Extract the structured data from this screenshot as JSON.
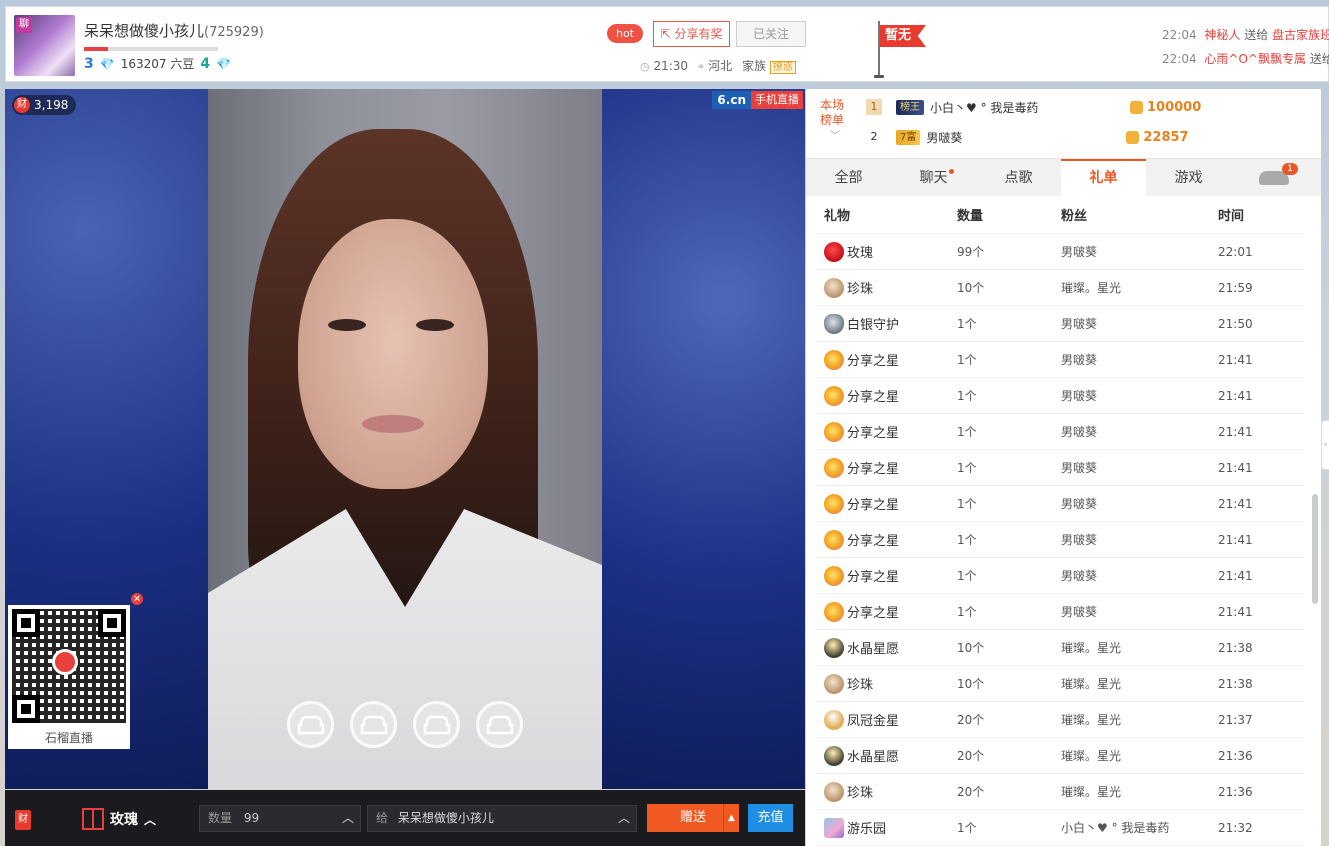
{
  "header": {
    "anchor_name": "呆呆想做傻小孩儿",
    "room_id": "(725929)",
    "avatar_badge": "聊",
    "level_left": "3",
    "coins_text": "163207 六豆",
    "level_right": "4",
    "level_progress": 0.18,
    "hot_label": "hot",
    "share_label": "分享有奖",
    "follow_label": "已关注",
    "time": "21:30",
    "location": "河北",
    "family_label": "家族",
    "family_badge": "撩惑",
    "flag_text": "暂无"
  },
  "gift_feed": [
    {
      "time": "22:04",
      "user": "神秘人",
      "verb": "送给",
      "target": "盘古家族班"
    },
    {
      "time": "22:04",
      "user": "心雨^O^飘飘专属",
      "verb": "送给",
      "target": ""
    }
  ],
  "video": {
    "viewer_coin": "财",
    "viewer_count": "3,198",
    "logo_text": "6.cn",
    "logo_tag": "手机直播",
    "qr_label": "石榴直播",
    "qr_close": "×"
  },
  "controls": {
    "coin_icon": "财",
    "gift_name": "玫瑰",
    "qty_label": "数量",
    "qty_value": "99",
    "to_label": "给",
    "to_value": "呆呆想做傻小孩儿",
    "send_label": "赠送",
    "recharge_label": "充值"
  },
  "rank": {
    "label": "本场榜单",
    "rows": [
      {
        "no": "1",
        "tag": "榜王",
        "name": "小白丶♥ ° 我是毒药",
        "score": "100000"
      },
      {
        "no": "2",
        "tag": "7富",
        "name": "男啵葵",
        "score": "22857"
      }
    ]
  },
  "tabs": [
    {
      "label": "全部"
    },
    {
      "label": "聊天"
    },
    {
      "label": "点歌"
    },
    {
      "label": "礼单"
    },
    {
      "label": "游戏"
    },
    {
      "label": "1"
    }
  ],
  "gift_table": {
    "headers": [
      "礼物",
      "数量",
      "粉丝",
      "时间"
    ],
    "rows": [
      {
        "icon": "rose",
        "gift": "玫瑰",
        "qty": "99个",
        "fan": "男啵葵",
        "time": "22:01"
      },
      {
        "icon": "pearl",
        "gift": "珍珠",
        "qty": "10个",
        "fan": "璀璨。星光",
        "time": "21:59"
      },
      {
        "icon": "shield",
        "gift": "白银守护",
        "qty": "1个",
        "fan": "男啵葵",
        "time": "21:50"
      },
      {
        "icon": "star",
        "gift": "分享之星",
        "qty": "1个",
        "fan": "男啵葵",
        "time": "21:41"
      },
      {
        "icon": "star",
        "gift": "分享之星",
        "qty": "1个",
        "fan": "男啵葵",
        "time": "21:41"
      },
      {
        "icon": "star",
        "gift": "分享之星",
        "qty": "1个",
        "fan": "男啵葵",
        "time": "21:41"
      },
      {
        "icon": "star",
        "gift": "分享之星",
        "qty": "1个",
        "fan": "男啵葵",
        "time": "21:41"
      },
      {
        "icon": "star",
        "gift": "分享之星",
        "qty": "1个",
        "fan": "男啵葵",
        "time": "21:41"
      },
      {
        "icon": "star",
        "gift": "分享之星",
        "qty": "1个",
        "fan": "男啵葵",
        "time": "21:41"
      },
      {
        "icon": "star",
        "gift": "分享之星",
        "qty": "1个",
        "fan": "男啵葵",
        "time": "21:41"
      },
      {
        "icon": "star",
        "gift": "分享之星",
        "qty": "1个",
        "fan": "男啵葵",
        "time": "21:41"
      },
      {
        "icon": "crystal",
        "gift": "水晶星愿",
        "qty": "10个",
        "fan": "璀璨。星光",
        "time": "21:38"
      },
      {
        "icon": "pearl",
        "gift": "珍珠",
        "qty": "10个",
        "fan": "璀璨。星光",
        "time": "21:38"
      },
      {
        "icon": "crown",
        "gift": "凤冠金星",
        "qty": "20个",
        "fan": "璀璨。星光",
        "time": "21:37"
      },
      {
        "icon": "crystal",
        "gift": "水晶星愿",
        "qty": "20个",
        "fan": "璀璨。星光",
        "time": "21:36"
      },
      {
        "icon": "pearl",
        "gift": "珍珠",
        "qty": "20个",
        "fan": "璀璨。星光",
        "time": "21:36"
      },
      {
        "icon": "park",
        "gift": "游乐园",
        "qty": "1个",
        "fan": "小白丶♥ ° 我是毒药",
        "time": "21:32"
      }
    ]
  }
}
